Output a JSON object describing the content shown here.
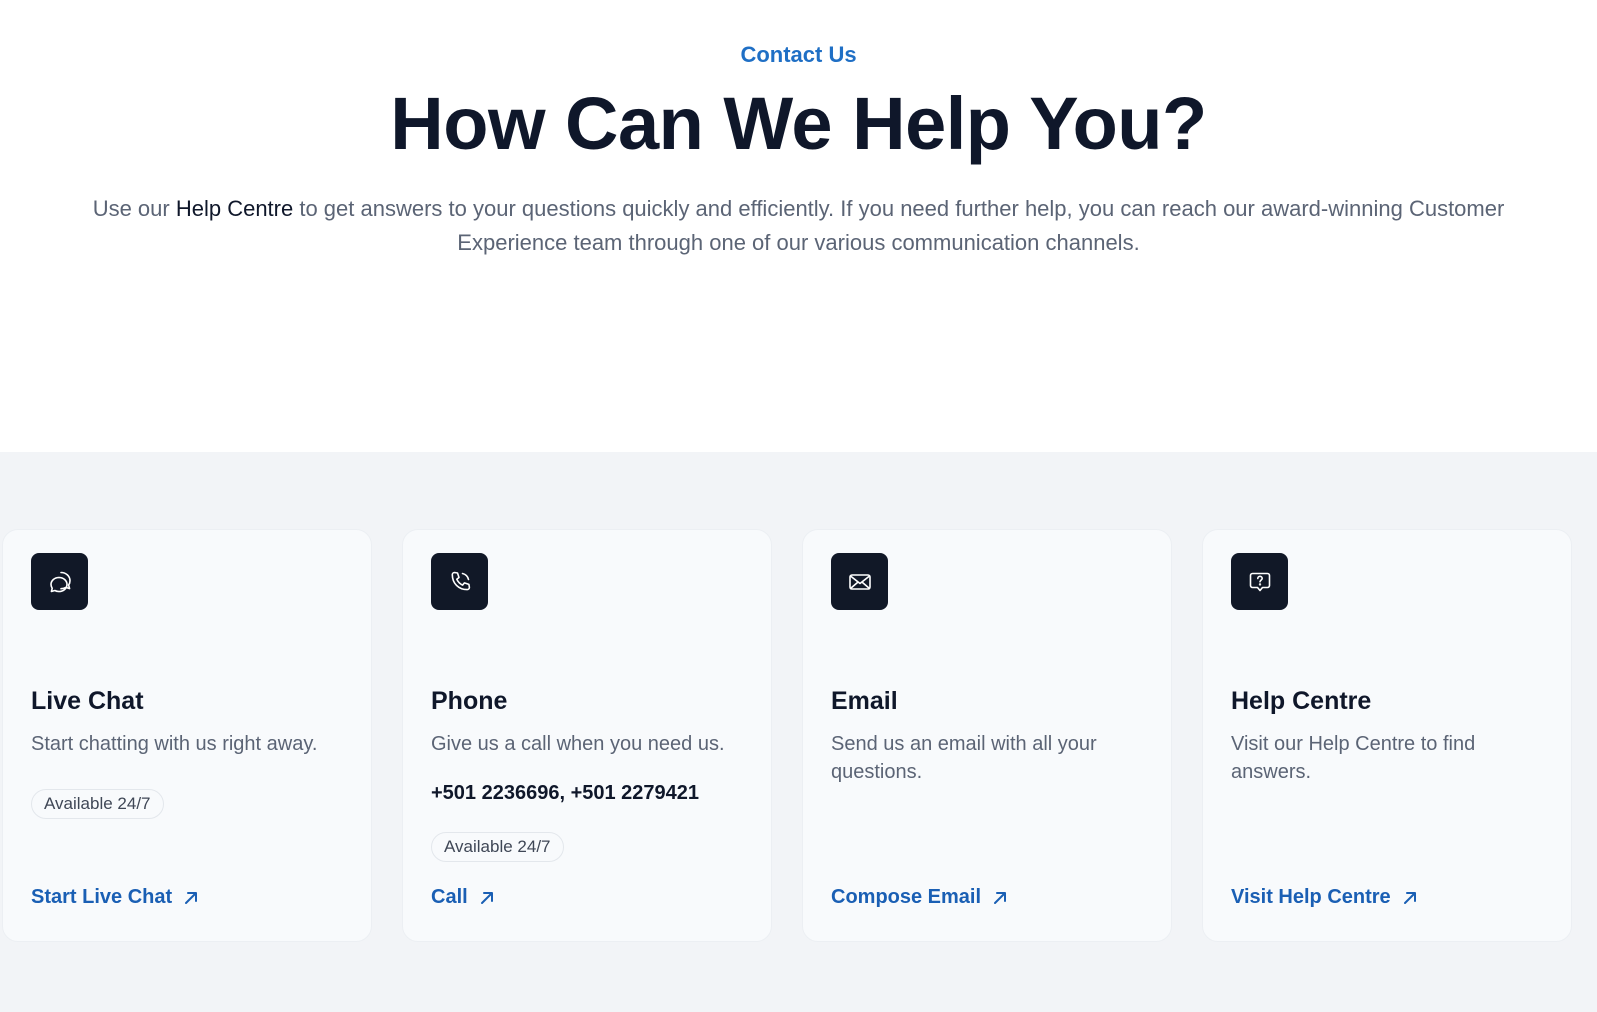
{
  "hero": {
    "eyebrow": "Contact Us",
    "title": "How Can We Help You?",
    "lede_before": "Use our ",
    "lede_link": "Help Centre",
    "lede_after": " to get answers to your questions quickly and efficiently. If you need further help, you can reach our award-winning Customer Experience team through one of our various communication channels."
  },
  "cards": [
    {
      "icon": "chat-icon",
      "title": "Live Chat",
      "description": "Start chatting with us right away.",
      "badge": "Available 24/7",
      "link": "Start Live Chat"
    },
    {
      "icon": "phone-icon",
      "title": "Phone",
      "description": "Give us a call when you need us.",
      "phone": "+501 2236696, +501 2279421",
      "badge": "Available 24/7",
      "link": "Call"
    },
    {
      "icon": "envelope-icon",
      "title": "Email",
      "description": "Send us an email with all your questions.",
      "link": "Compose Email"
    },
    {
      "icon": "help-question-icon",
      "title": "Help Centre",
      "description": "Visit our Help Centre to find answers.",
      "link": "Visit Help Centre"
    }
  ],
  "colors": {
    "accent": "#1a5fb4",
    "heading": "#0f172a",
    "muted": "#5b6475",
    "icon_bg": "#111827",
    "section_bg": "#f2f4f7"
  }
}
